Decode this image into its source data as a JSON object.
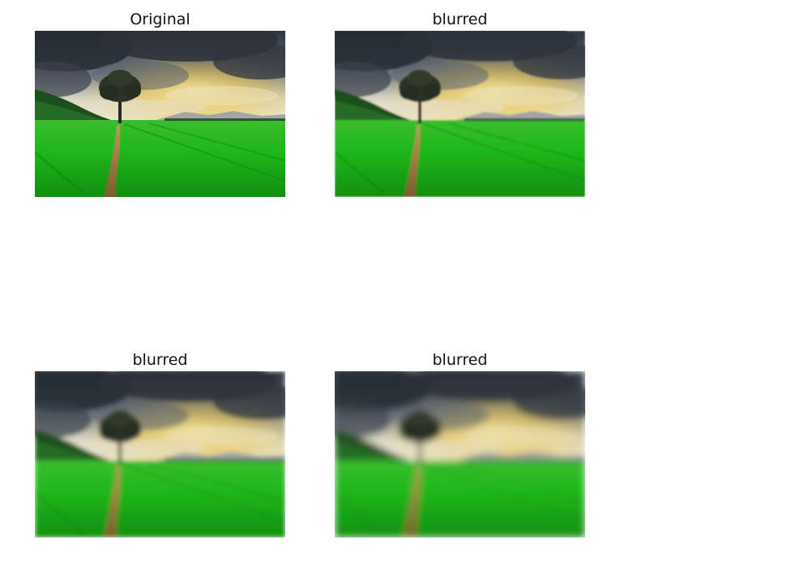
{
  "figure": {
    "panels": [
      {
        "title": "Original",
        "image": "landscape-tree-field",
        "blur_level": 0
      },
      {
        "title": "blurred",
        "image": "landscape-tree-field",
        "blur_level": 1
      },
      {
        "title": "blurred",
        "image": "landscape-tree-field",
        "blur_level": 2
      },
      {
        "title": "blurred",
        "image": "landscape-tree-field",
        "blur_level": 3
      }
    ]
  },
  "colors": {
    "sky_dark": "#2e3640",
    "sky_light": "#e9e2c6",
    "sun_glow": "#f3d36a",
    "grass": "#1fb81a",
    "grass_dark": "#0d7a10",
    "path": "#9a7b3a",
    "tree": "#2a2a22"
  }
}
